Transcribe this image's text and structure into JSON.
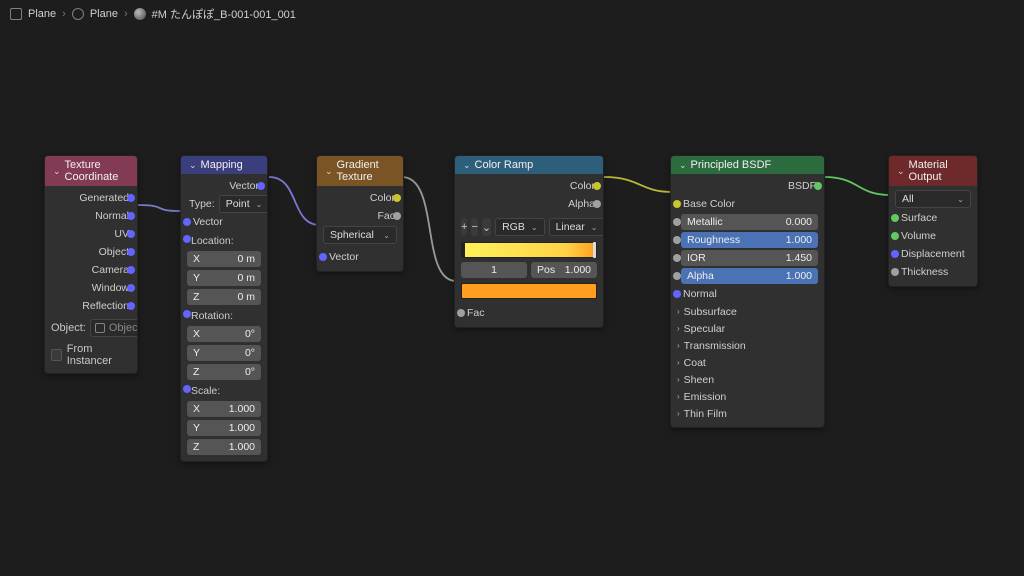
{
  "breadcrumb": {
    "item1": "Plane",
    "item2": "Plane",
    "item3": "#M たんぽぽ_B-001-001_001"
  },
  "nodes": {
    "texcoord": {
      "title": "Texture Coordinate",
      "outputs": [
        "Generated",
        "Normal",
        "UV",
        "Object",
        "Camera",
        "Window",
        "Reflection"
      ],
      "object_label": "Object:",
      "object_placeholder": "Object",
      "from_instancer": "From Instancer"
    },
    "mapping": {
      "title": "Mapping",
      "out_vector": "Vector",
      "type_label": "Type:",
      "type_value": "Point",
      "in_vector": "Vector",
      "location": {
        "label": "Location:",
        "x": "X",
        "y": "Y",
        "z": "Z",
        "xv": "0 m",
        "yv": "0 m",
        "zv": "0 m"
      },
      "rotation": {
        "label": "Rotation:",
        "x": "X",
        "y": "Y",
        "z": "Z",
        "xv": "0°",
        "yv": "0°",
        "zv": "0°"
      },
      "scale": {
        "label": "Scale:",
        "x": "X",
        "y": "Y",
        "z": "Z",
        "xv": "1.000",
        "yv": "1.000",
        "zv": "1.000"
      }
    },
    "gradient": {
      "title": "Gradient Texture",
      "out_color": "Color",
      "out_fac": "Fac",
      "type": "Spherical",
      "in_vector": "Vector"
    },
    "colorramp": {
      "title": "Color Ramp",
      "out_color": "Color",
      "out_alpha": "Alpha",
      "mode": "RGB",
      "interp": "Linear",
      "stop_idx": "1",
      "pos_label": "Pos",
      "pos_val": "1.000",
      "in_fac": "Fac",
      "swatch": "#ff9e1f"
    },
    "bsdf": {
      "title": "Principled BSDF",
      "out": "BSDF",
      "base_color": "Base Color",
      "metallic": {
        "label": "Metallic",
        "val": "0.000"
      },
      "roughness": {
        "label": "Roughness",
        "val": "1.000"
      },
      "ior": {
        "label": "IOR",
        "val": "1.450"
      },
      "alpha": {
        "label": "Alpha",
        "val": "1.000"
      },
      "normal": "Normal",
      "groups": [
        "Subsurface",
        "Specular",
        "Transmission",
        "Coat",
        "Sheen",
        "Emission",
        "Thin Film"
      ]
    },
    "output": {
      "title": "Material Output",
      "target": "All",
      "surface": "Surface",
      "volume": "Volume",
      "displacement": "Displacement",
      "thickness": "Thickness"
    }
  }
}
